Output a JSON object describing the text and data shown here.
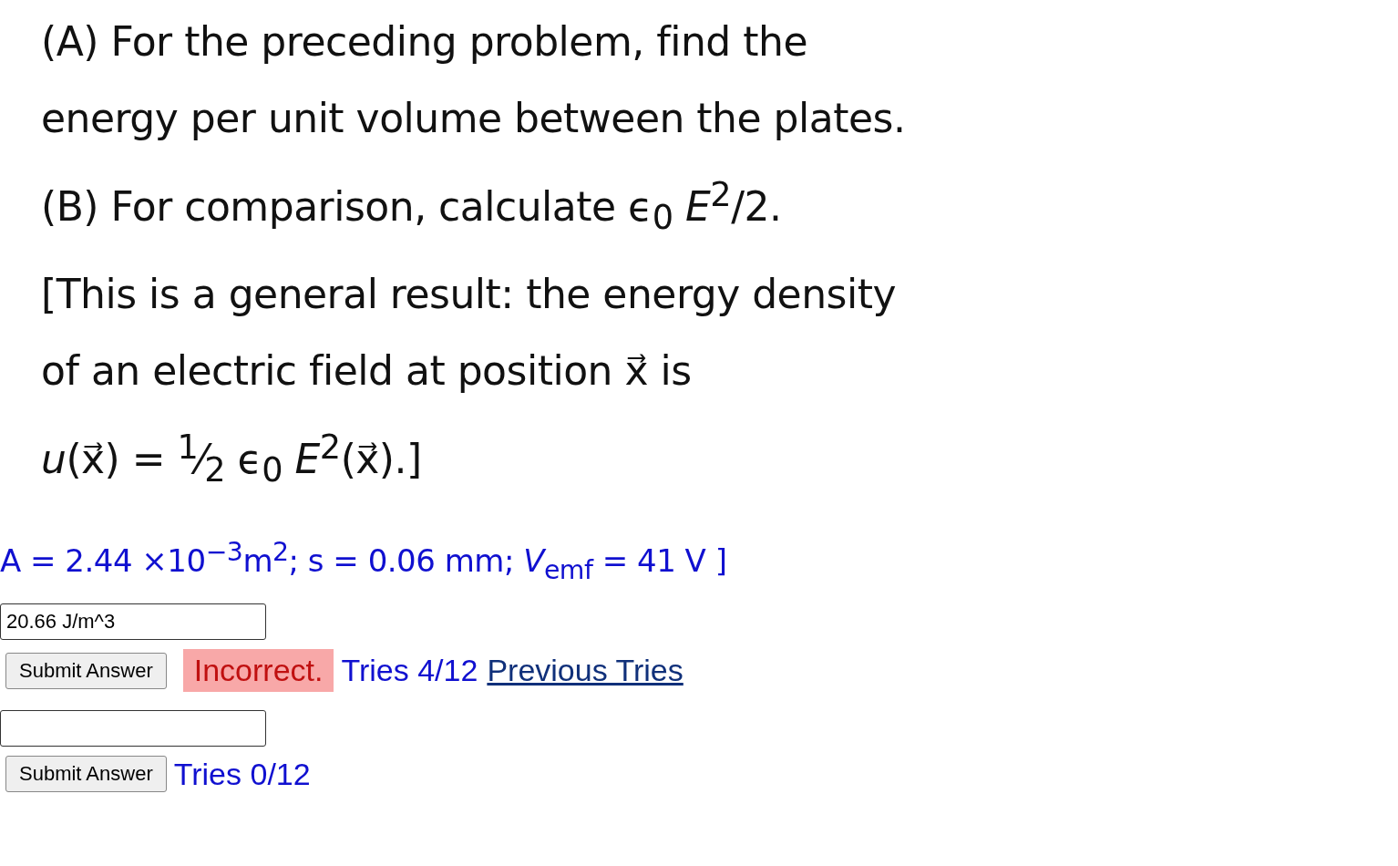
{
  "problem": {
    "lines": [
      "(A) For the preceding problem, find the",
      "energy per unit volume between the plates.",
      "(B) For comparison, calculate ϵ$_{0}$ *E*$^{2}$/2.",
      "[This is a general result: the energy density",
      "of an electric field at position x⃗ is",
      "*u*(x⃗) = $^{1}$⁄$_{2}$ ϵ$_{0}$ *E*$^{2}$(x⃗).]"
    ]
  },
  "given": "A = 2.44 ×10$^{−3}$m$^{2}$; s = 0.06 mm; *V*$_{emf}$ = 41 V ]",
  "parts": [
    {
      "answer": "20.66 J/m^3",
      "button": "Submit Answer",
      "status": {
        "kind": "incorrect",
        "label": "Incorrect."
      },
      "tries": "Tries 4/12",
      "link": "Previous Tries"
    },
    {
      "button": "Submit Answer",
      "tries": "Tries 0/12"
    }
  ]
}
